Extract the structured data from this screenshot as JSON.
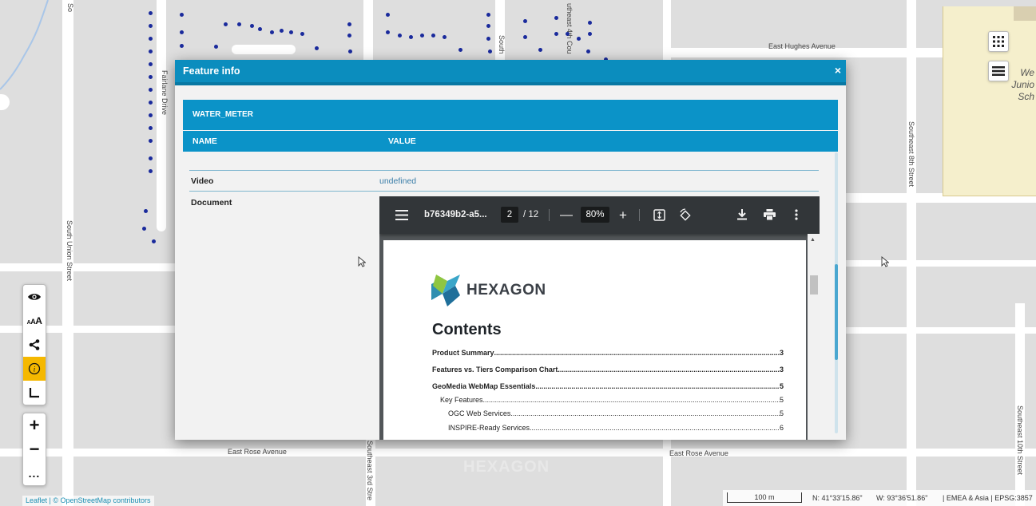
{
  "map": {
    "streets": {
      "east_hughes_avenue": "East Hughes Avenue",
      "east_rose_avenue_left": "East Rose Avenue",
      "east_rose_avenue_right": "East Rose Avenue",
      "fairlane_drive": "Fairlane Drive",
      "south_union_street": "South Union Street",
      "southeast_8th_street": "Southeast 8th Street",
      "southeast_10th_street": "Southeast 10th Street",
      "southeast_3rd_street": "Southeast 3rd Stre",
      "southeast_4th_court": "utheast 4th Cou",
      "south_fragment": "South",
      "top_fragment": "So"
    },
    "school_label": [
      "We",
      "Junio",
      "Sch"
    ],
    "watermark": "HEXAGON"
  },
  "right_buttons": {
    "apps_icon": "apps-grid-icon",
    "layers_icon": "menu-icon"
  },
  "left_toolbar": {
    "group1": [
      {
        "name": "eye-icon",
        "glyph": "👁"
      },
      {
        "name": "text-size-icon",
        "glyph": "AAA"
      },
      {
        "name": "share-icon",
        "glyph": "<"
      },
      {
        "name": "info-icon",
        "glyph": "i",
        "active": true
      },
      {
        "name": "measure-icon",
        "glyph": "L"
      }
    ],
    "zoom_in": "+",
    "zoom_out": "−",
    "more": "..."
  },
  "attribution": "Leaflet | © OpenStreetMap contributors",
  "status_bar": {
    "scale": "100 m",
    "north": "N: 41°33'15.86\"",
    "west": "W: 93°36'51.86\"",
    "projection": "| EMEA & Asia | EPSG:3857"
  },
  "dialog": {
    "title": "Feature info",
    "close": "×",
    "layer": "WATER_METER",
    "columns": {
      "name": "NAME",
      "value": "VALUE"
    },
    "rows": [
      {
        "key": "Video",
        "value": "undefined"
      },
      {
        "key": "Document",
        "value": ""
      }
    ]
  },
  "pdf": {
    "filename": "b76349b2-a5...",
    "page_current": "2",
    "page_total": "/ 12",
    "zoom": "80%",
    "logo_text": "HEXAGON",
    "contents_title": "Contents",
    "toc": [
      {
        "title": "Product Summary",
        "page": "3",
        "level": 0
      },
      {
        "title": "Features vs. Tiers Comparison Chart",
        "page": "3",
        "level": 0
      },
      {
        "title": "GeoMedia WebMap Essentials",
        "page": "5",
        "level": 0
      },
      {
        "title": "Key Features",
        "page": "5",
        "level": 1
      },
      {
        "title": "OGC Web Services",
        "page": "5",
        "level": 2
      },
      {
        "title": "INSPIRE-Ready Services",
        "page": "6",
        "level": 2
      }
    ]
  }
}
